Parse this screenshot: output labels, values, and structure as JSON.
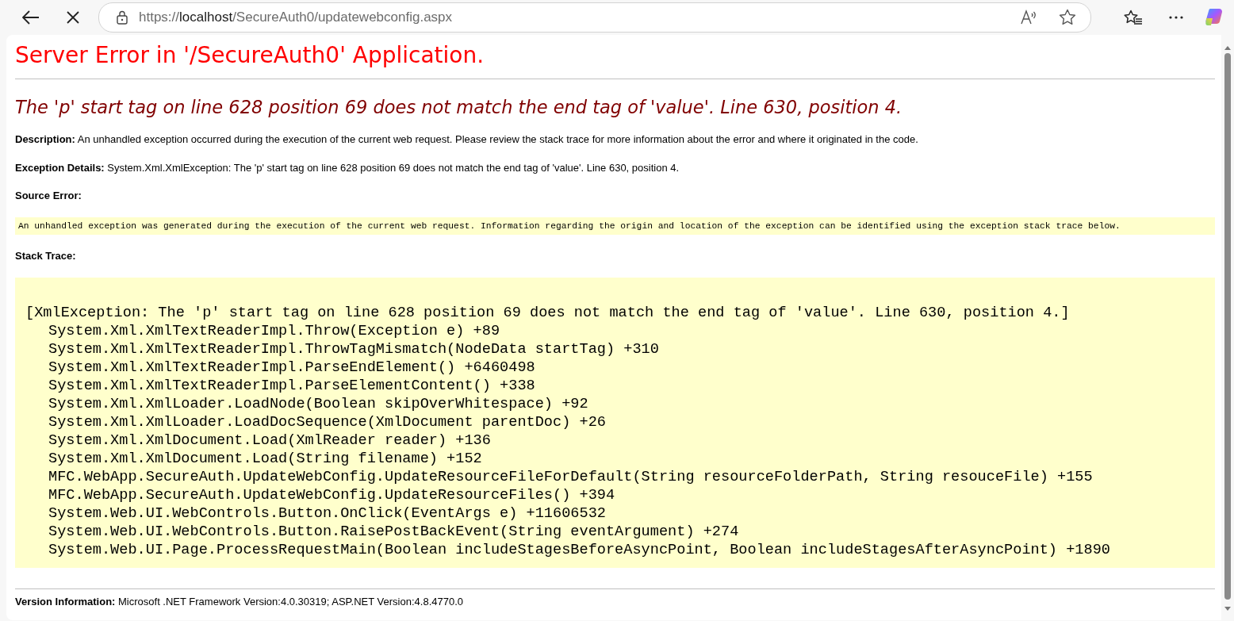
{
  "browser": {
    "url": {
      "scheme": "https://",
      "host": "localhost",
      "path": "/SecureAuth0/updatewebconfig.aspx"
    }
  },
  "page": {
    "title": "Server Error in '/SecureAuth0' Application.",
    "error_message": "The 'p' start tag on line 628 position 69 does not match the end tag of 'value'. Line 630, position 4.",
    "description": "**Description:** An unhandled exception occurred during the execution of the current web request. Please review the stack trace for more information about the error and where it originated in the code.",
    "exception_details": "**Exception Details:** System.Xml.XmlException: The 'p' start tag on line 628 position 69 does not match the end tag of 'value'. Line 630, position 4.",
    "source_error_heading": "Source Error:",
    "source_error": "An unhandled exception was generated during the execution of the current web request. Information regarding the origin and location of the exception can be identified using the exception stack trace below.",
    "stack_trace_heading": "Stack Trace:",
    "stack_trace": [
      {
        "kind": "exception",
        "text": "[XmlException: The 'p' start tag on line 628 position 69 does not match the end tag of 'value'. Line 630, position 4.]"
      },
      {
        "kind": "frame",
        "text": "System.Xml.XmlTextReaderImpl.Throw(Exception e) +89"
      },
      {
        "kind": "frame",
        "text": "System.Xml.XmlTextReaderImpl.ThrowTagMismatch(NodeData startTag) +310"
      },
      {
        "kind": "frame",
        "text": "System.Xml.XmlTextReaderImpl.ParseEndElement() +6460498"
      },
      {
        "kind": "frame",
        "text": "System.Xml.XmlTextReaderImpl.ParseElementContent() +338"
      },
      {
        "kind": "frame",
        "text": "System.Xml.XmlLoader.LoadNode(Boolean skipOverWhitespace) +92"
      },
      {
        "kind": "frame",
        "text": "System.Xml.XmlLoader.LoadDocSequence(XmlDocument parentDoc) +26"
      },
      {
        "kind": "frame",
        "text": "System.Xml.XmlDocument.Load(XmlReader reader) +136"
      },
      {
        "kind": "frame",
        "text": "System.Xml.XmlDocument.Load(String filename) +152"
      },
      {
        "kind": "frame",
        "text": "MFC.WebApp.SecureAuth.UpdateWebConfig.UpdateResourceFileForDefault(String resourceFolderPath, String resouceFile) +155"
      },
      {
        "kind": "frame",
        "text": "MFC.WebApp.SecureAuth.UpdateWebConfig.UpdateResourceFiles() +394"
      },
      {
        "kind": "frame",
        "text": "System.Web.UI.WebControls.Button.OnClick(EventArgs e) +11606532"
      },
      {
        "kind": "frame",
        "text": "System.Web.UI.WebControls.Button.RaisePostBackEvent(String eventArgument) +274"
      },
      {
        "kind": "frame",
        "text": "System.Web.UI.Page.ProcessRequestMain(Boolean includeStagesBeforeAsyncPoint, Boolean includeStagesAfterAsyncPoint) +1890"
      }
    ],
    "version_info": "**Version Information:** Microsoft .NET Framework Version:4.0.30319; ASP.NET Version:4.8.4770.0"
  }
}
